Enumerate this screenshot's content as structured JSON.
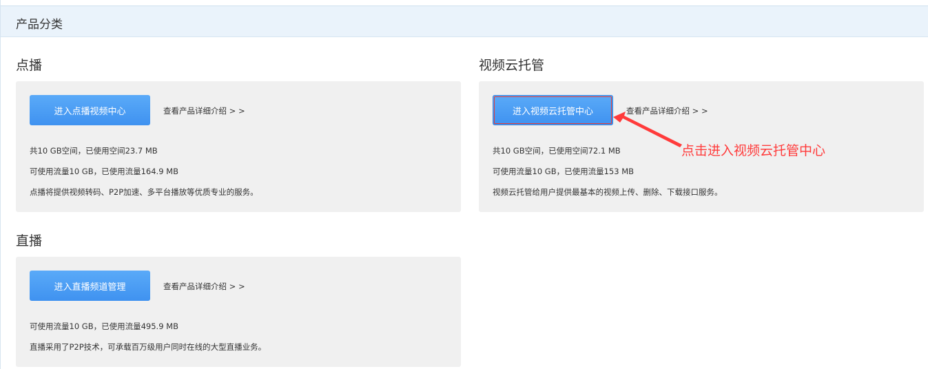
{
  "header": {
    "title": "产品分类"
  },
  "sections": {
    "vod": {
      "title": "点播",
      "button_label": "进入点播视频中心",
      "detail_link": "查看产品详细介绍 > >",
      "storage": "共10 GB空间，已使用空间23.7 MB",
      "traffic": "可使用流量10 GB，已使用流量164.9 MB",
      "description": "点播将提供视频转码、P2P加速、多平台播放等优质专业的服务。"
    },
    "cloud": {
      "title": "视频云托管",
      "button_label": "进入视频云托管中心",
      "detail_link": "查看产品详细介绍 > >",
      "storage": "共10 GB空间，已使用空间72.1 MB",
      "traffic": "可使用流量10 GB，已使用流量153 MB",
      "description": "视频云托管给用户提供最基本的视频上传、删除、下载接口服务。"
    },
    "live": {
      "title": "直播",
      "button_label": "进入直播频道管理",
      "detail_link": "查看产品详细介绍 > >",
      "traffic": "可使用流量10 GB，已使用流量495.9 MB",
      "description": "直播采用了P2P技术，可承载百万级用户同时在线的大型直播业务。"
    }
  },
  "annotation": {
    "text": "点击进入视频云托管中心",
    "color": "#ff3b3b"
  },
  "colors": {
    "button": "#4a9cf5",
    "card_bg": "#f0f0f0",
    "header_bg": "#eaf3fb"
  }
}
